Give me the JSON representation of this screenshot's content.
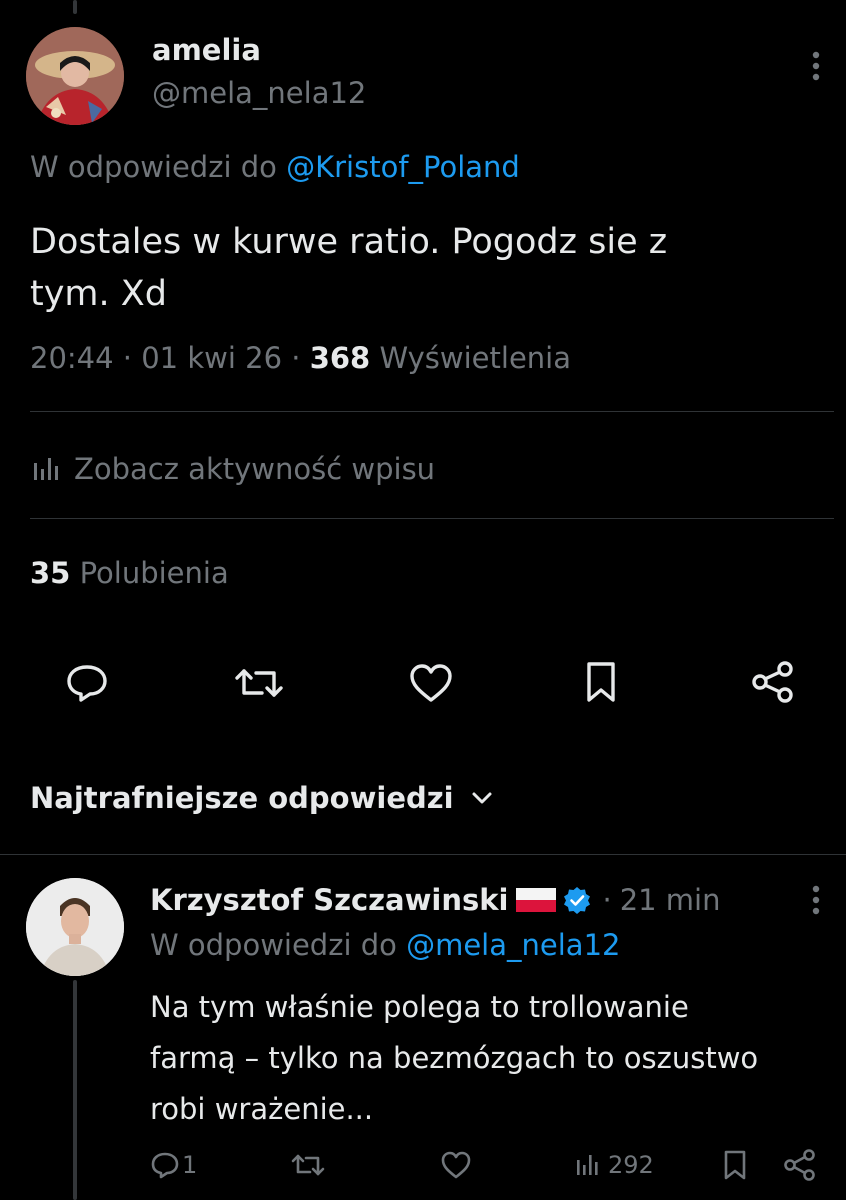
{
  "main_tweet": {
    "display_name": "amelia",
    "handle": "@mela_nela12",
    "reply_prefix": "W odpowiedzi do",
    "reply_to": "@Kristof_Poland",
    "text_line1": "Dostales w kurwe ratio. Pogodz sie z",
    "text_line2": "tym. Xd",
    "time": "20:44",
    "date": "01 kwi 26",
    "views_count": "368",
    "views_label": "Wyświetlenia",
    "activity_label": "Zobacz aktywność wpisu",
    "likes_count": "35",
    "likes_label": "Polubienia"
  },
  "replies_header": {
    "label": "Najtrafniejsze odpowiedzi"
  },
  "reply": {
    "display_name": "Krzysztof Szczawinski",
    "time": "21 min",
    "reply_prefix": "W odpowiedzi do",
    "reply_to": "@mela_nela12",
    "text_line1": "Na tym właśnie polega to trollowanie",
    "text_line2": "farmą – tylko na bezmózgach to oszustwo",
    "text_line3": "robi wrażenie...",
    "reply_count": "1",
    "views_count": "292"
  },
  "colors": {
    "background": "#000000",
    "text": "#e7e9ea",
    "muted": "#71767b",
    "link": "#1d9bf0",
    "divider": "#2f3336",
    "verified": "#1d9bf0"
  }
}
